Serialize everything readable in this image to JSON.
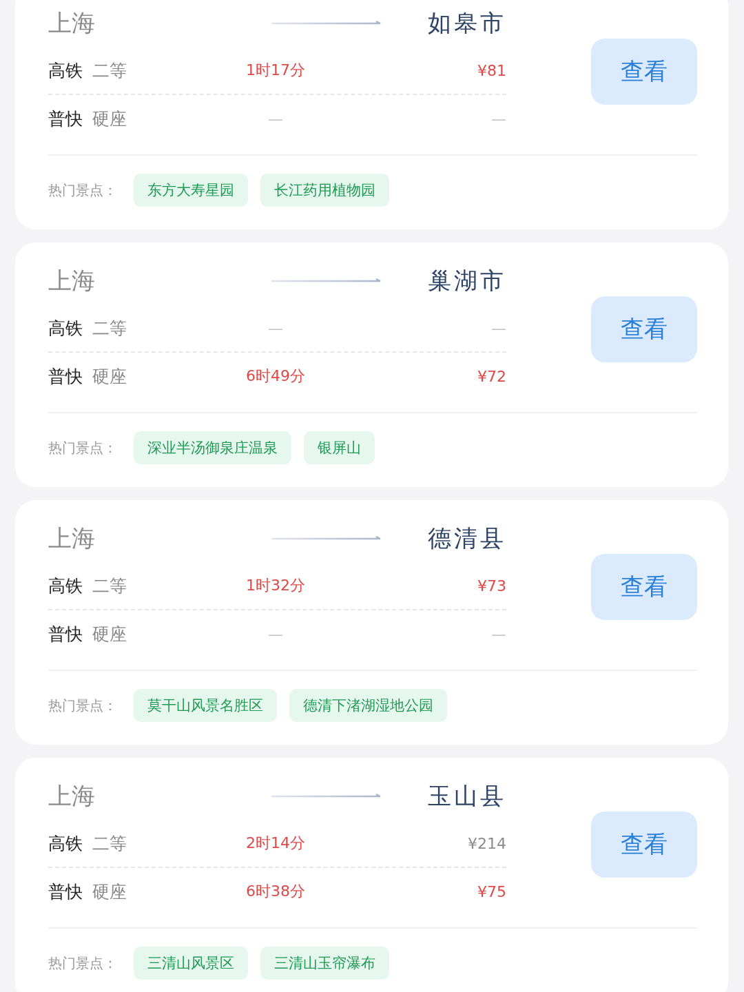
{
  "routes": [
    {
      "origin": "上海",
      "destination": "如皋市",
      "button": "查看",
      "fares": [
        {
          "train": "高铁",
          "seat": "二等",
          "kind": "available",
          "duration": "1时17分",
          "price": "¥81",
          "highlighted": true
        },
        {
          "train": "普快",
          "seat": "硬座",
          "kind": "none",
          "duration": "—",
          "price": "—"
        }
      ],
      "spots_label": "热门景点：",
      "spots": [
        "东方大寿星园",
        "长江药用植物园"
      ]
    },
    {
      "origin": "上海",
      "destination": "巢湖市",
      "button": "查看",
      "fares": [
        {
          "train": "高铁",
          "seat": "二等",
          "kind": "none",
          "duration": "—",
          "price": "—"
        },
        {
          "train": "普快",
          "seat": "硬座",
          "kind": "available",
          "duration": "6时49分",
          "price": "¥72",
          "highlighted": true
        }
      ],
      "spots_label": "热门景点：",
      "spots": [
        "深业半汤御泉庄温泉",
        "银屏山"
      ]
    },
    {
      "origin": "上海",
      "destination": "德清县",
      "button": "查看",
      "fares": [
        {
          "train": "高铁",
          "seat": "二等",
          "kind": "available",
          "duration": "1时32分",
          "price": "¥73",
          "highlighted": true
        },
        {
          "train": "普快",
          "seat": "硬座",
          "kind": "none",
          "duration": "—",
          "price": "—"
        }
      ],
      "spots_label": "热门景点：",
      "spots": [
        "莫干山风景名胜区",
        "德清下渚湖湿地公园"
      ]
    },
    {
      "origin": "上海",
      "destination": "玉山县",
      "button": "查看",
      "fares": [
        {
          "train": "高铁",
          "seat": "二等",
          "kind": "available",
          "duration": "2时14分",
          "price": "¥214",
          "highlighted": false
        },
        {
          "train": "普快",
          "seat": "硬座",
          "kind": "available",
          "duration": "6时38分",
          "price": "¥75",
          "highlighted": true
        }
      ],
      "spots_label": "热门景点：",
      "spots": [
        "三清山风景区",
        "三清山玉帘瀑布"
      ]
    }
  ]
}
